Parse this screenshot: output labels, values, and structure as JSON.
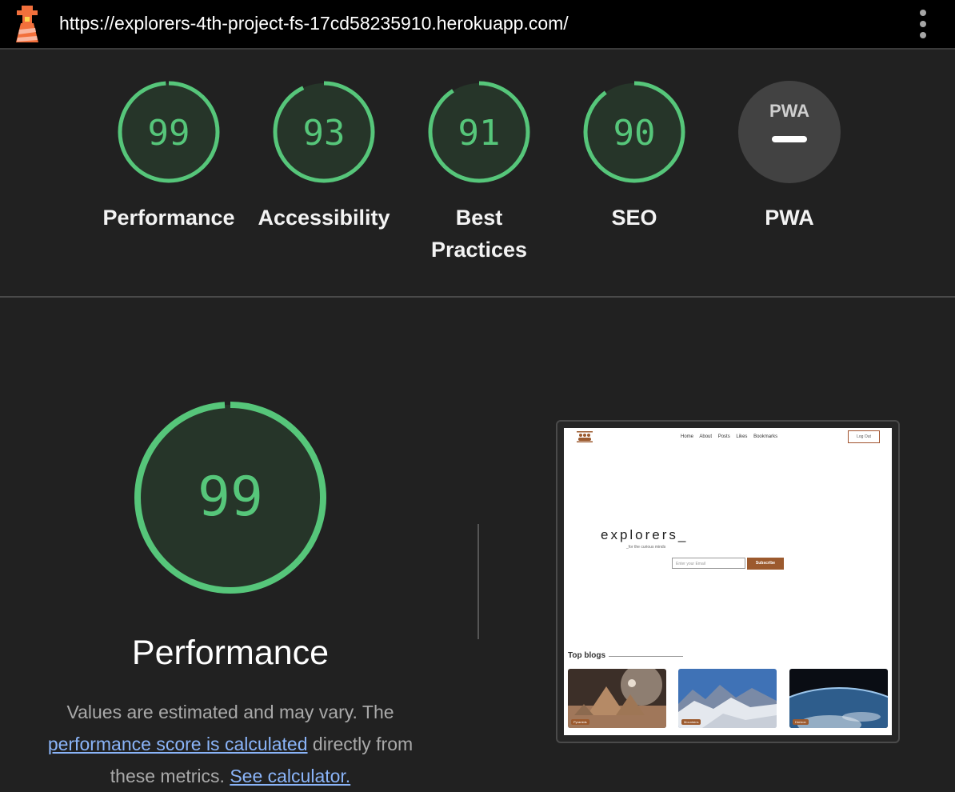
{
  "browser": {
    "url": "https://explorers-4th-project-fs-17cd58235910.herokuapp.com/"
  },
  "categories": [
    {
      "name": "performance",
      "score": 99,
      "label": "Performance"
    },
    {
      "name": "accessibility",
      "score": 93,
      "label": "Accessibility"
    },
    {
      "name": "best-practices",
      "score": 91,
      "label_line1": "Best",
      "label_line2": "Practices"
    },
    {
      "name": "seo",
      "score": 90,
      "label": "SEO"
    },
    {
      "name": "pwa",
      "label": "PWA",
      "badge_text": "PWA"
    }
  ],
  "colors": {
    "pass": "#56c67a",
    "gauge_bg": "#263529",
    "pwa_bg": "#424242"
  },
  "detail": {
    "score": 99,
    "title": "Performance",
    "desc_prefix": "Values are estimated and may vary. The",
    "desc_link1": "performance score is calculated",
    "desc_middle": "directly from",
    "desc_line3_prefix": "these metrics.",
    "desc_link2": "See calculator."
  },
  "screenshot": {
    "nav": [
      "Home",
      "About",
      "Posts",
      "Likes",
      "Bookmarks"
    ],
    "logout": "Log Out",
    "brand": "explorers_",
    "tagline": "_for the curious minds",
    "email_placeholder": "Enter your Email",
    "subscribe": "Subscribe",
    "top_blogs": "Top blogs",
    "cards": [
      "Pyramids",
      "Mountains",
      "Horizon"
    ]
  }
}
